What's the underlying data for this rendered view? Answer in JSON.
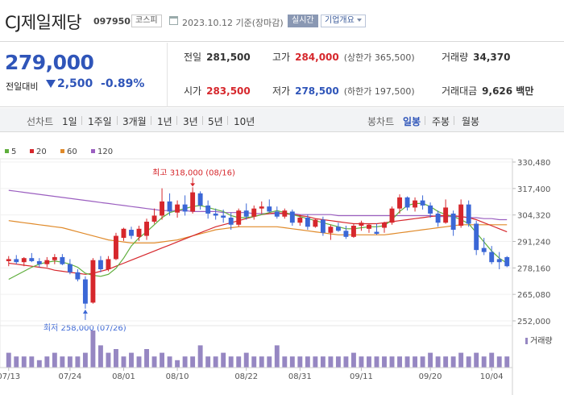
{
  "header": {
    "company": "CJ제일제당",
    "code": "097950",
    "market": "코스피",
    "date": "2023.10.12 기준(장마감)",
    "live_label": "실시간",
    "company_info_label": "기업개요"
  },
  "price": {
    "current": "279,000",
    "vs_prev_label": "전일대비",
    "change_amount": "2,500",
    "change_pct": "-0.89%",
    "prev_close_label": "전일",
    "prev_close": "281,500",
    "high_label": "고가",
    "high": "284,000",
    "upper_limit": "(상한가 365,500)",
    "volume_label": "거래량",
    "volume": "34,370",
    "open_label": "시가",
    "open": "283,500",
    "low_label": "저가",
    "low": "278,500",
    "lower_limit": "(하한가 197,500)",
    "amount_label": "거래대금",
    "amount": "9,626 백만"
  },
  "toolbar": {
    "line_label": "선차트",
    "periods": [
      "1일",
      "1주일",
      "3개월",
      "1년",
      "3년",
      "5년",
      "10년"
    ],
    "candle_label": "봉차트",
    "candle_periods": [
      "일봉",
      "주봉",
      "월봉"
    ],
    "active_candle": "일봉"
  },
  "legend": [
    {
      "label": "5",
      "color": "#5fae3c"
    },
    {
      "label": "20",
      "color": "#d6272c"
    },
    {
      "label": "60",
      "color": "#e08a2a"
    },
    {
      "label": "120",
      "color": "#9b5fc0"
    }
  ],
  "chart_data": {
    "type": "candlestick",
    "y_ticks": [
      "330,480",
      "317,400",
      "304,320",
      "291,240",
      "278,160",
      "265,080",
      "252,000"
    ],
    "ylim": [
      252000,
      330480
    ],
    "x_labels": [
      "07/13",
      "07/24",
      "08/01",
      "08/10",
      "08/22",
      "08/31",
      "09/11",
      "09/20",
      "10/04"
    ],
    "max_annotation": "최고 318,000 (08/16)",
    "min_annotation": "최저 258,000 (07/26)",
    "volume_legend": "거래량",
    "colors": {
      "up": "#d6272c",
      "down": "#3b67d6",
      "volume": "#9687c2"
    },
    "candles": [
      {
        "o": 281500,
        "h": 284000,
        "l": 279000,
        "c": 282500
      },
      {
        "o": 282500,
        "h": 284500,
        "l": 280000,
        "c": 281000
      },
      {
        "o": 281000,
        "h": 283500,
        "l": 279000,
        "c": 283000
      },
      {
        "o": 283000,
        "h": 285500,
        "l": 281000,
        "c": 281500
      },
      {
        "o": 281500,
        "h": 283000,
        "l": 278500,
        "c": 280000
      },
      {
        "o": 280000,
        "h": 283500,
        "l": 278500,
        "c": 282000
      },
      {
        "o": 282000,
        "h": 285000,
        "l": 280000,
        "c": 283500
      },
      {
        "o": 283500,
        "h": 285000,
        "l": 279500,
        "c": 280000
      },
      {
        "o": 280000,
        "h": 282500,
        "l": 275000,
        "c": 276000
      },
      {
        "o": 276000,
        "h": 277500,
        "l": 271500,
        "c": 272500
      },
      {
        "o": 272500,
        "h": 274000,
        "l": 258000,
        "c": 260500
      },
      {
        "o": 261000,
        "h": 283000,
        "l": 260500,
        "c": 282000
      },
      {
        "o": 282000,
        "h": 284000,
        "l": 276000,
        "c": 277500
      },
      {
        "o": 277500,
        "h": 284000,
        "l": 276500,
        "c": 282500
      },
      {
        "o": 282500,
        "h": 295500,
        "l": 282000,
        "c": 294000
      },
      {
        "o": 293000,
        "h": 298000,
        "l": 291500,
        "c": 297500
      },
      {
        "o": 297000,
        "h": 298500,
        "l": 292500,
        "c": 294000
      },
      {
        "o": 293500,
        "h": 299000,
        "l": 291500,
        "c": 297500
      },
      {
        "o": 294000,
        "h": 302500,
        "l": 292000,
        "c": 301000
      },
      {
        "o": 301000,
        "h": 307500,
        "l": 300000,
        "c": 304000
      },
      {
        "o": 304000,
        "h": 317500,
        "l": 302000,
        "c": 311000
      },
      {
        "o": 311000,
        "h": 315000,
        "l": 304000,
        "c": 306000
      },
      {
        "o": 305500,
        "h": 311500,
        "l": 303000,
        "c": 309500
      },
      {
        "o": 309500,
        "h": 314000,
        "l": 304000,
        "c": 306000
      },
      {
        "o": 306000,
        "h": 318000,
        "l": 305000,
        "c": 315500
      },
      {
        "o": 315000,
        "h": 316000,
        "l": 307000,
        "c": 309000
      },
      {
        "o": 309000,
        "h": 311500,
        "l": 302500,
        "c": 305000
      },
      {
        "o": 305000,
        "h": 307500,
        "l": 302000,
        "c": 304000
      },
      {
        "o": 304000,
        "h": 307000,
        "l": 300500,
        "c": 303000
      },
      {
        "o": 303000,
        "h": 305500,
        "l": 297000,
        "c": 299500
      },
      {
        "o": 299500,
        "h": 307500,
        "l": 298500,
        "c": 306500
      },
      {
        "o": 306500,
        "h": 310000,
        "l": 302000,
        "c": 303500
      },
      {
        "o": 303500,
        "h": 309000,
        "l": 302000,
        "c": 307500
      },
      {
        "o": 307500,
        "h": 311000,
        "l": 305000,
        "c": 308500
      },
      {
        "o": 308500,
        "h": 312000,
        "l": 305500,
        "c": 306000
      },
      {
        "o": 306000,
        "h": 308500,
        "l": 302500,
        "c": 303500
      },
      {
        "o": 303500,
        "h": 307500,
        "l": 302500,
        "c": 306500
      },
      {
        "o": 306000,
        "h": 307000,
        "l": 299000,
        "c": 300500
      },
      {
        "o": 300500,
        "h": 304500,
        "l": 299000,
        "c": 303000
      },
      {
        "o": 303000,
        "h": 304500,
        "l": 297000,
        "c": 298500
      },
      {
        "o": 298500,
        "h": 302500,
        "l": 298000,
        "c": 302000
      },
      {
        "o": 302000,
        "h": 303500,
        "l": 294000,
        "c": 295500
      },
      {
        "o": 295500,
        "h": 299500,
        "l": 292000,
        "c": 298500
      },
      {
        "o": 298500,
        "h": 300500,
        "l": 296000,
        "c": 296500
      },
      {
        "o": 296500,
        "h": 299000,
        "l": 292500,
        "c": 293500
      },
      {
        "o": 293500,
        "h": 300000,
        "l": 293000,
        "c": 299000
      },
      {
        "o": 299000,
        "h": 301500,
        "l": 296500,
        "c": 300500
      },
      {
        "o": 297500,
        "h": 300000,
        "l": 295500,
        "c": 299500
      },
      {
        "o": 296000,
        "h": 300000,
        "l": 294500,
        "c": 295000
      },
      {
        "o": 298000,
        "h": 301000,
        "l": 295500,
        "c": 300500
      },
      {
        "o": 300500,
        "h": 308500,
        "l": 299500,
        "c": 307500
      },
      {
        "o": 307500,
        "h": 314500,
        "l": 305000,
        "c": 313000
      },
      {
        "o": 313000,
        "h": 313500,
        "l": 306500,
        "c": 308000
      },
      {
        "o": 308000,
        "h": 313000,
        "l": 306000,
        "c": 311500
      },
      {
        "o": 311500,
        "h": 314000,
        "l": 307000,
        "c": 309000
      },
      {
        "o": 309000,
        "h": 310500,
        "l": 303000,
        "c": 305000
      },
      {
        "o": 305000,
        "h": 306500,
        "l": 298500,
        "c": 300500
      },
      {
        "o": 300500,
        "h": 312000,
        "l": 300000,
        "c": 308000
      },
      {
        "o": 305000,
        "h": 306500,
        "l": 294000,
        "c": 297000
      },
      {
        "o": 299000,
        "h": 312000,
        "l": 298000,
        "c": 309500
      },
      {
        "o": 309500,
        "h": 311500,
        "l": 298500,
        "c": 300000
      },
      {
        "o": 300000,
        "h": 301500,
        "l": 284500,
        "c": 287000
      },
      {
        "o": 288000,
        "h": 293000,
        "l": 284500,
        "c": 286000
      },
      {
        "o": 286000,
        "h": 289000,
        "l": 280000,
        "c": 281000
      },
      {
        "o": 282500,
        "h": 286000,
        "l": 277500,
        "c": 281000
      },
      {
        "o": 283500,
        "h": 284000,
        "l": 278500,
        "c": 279000
      }
    ],
    "volumes": [
      4,
      3,
      3,
      3,
      2,
      3,
      4,
      3,
      3,
      3,
      4,
      10,
      6,
      4,
      5,
      3,
      4,
      3,
      5,
      3,
      4,
      3,
      2,
      3,
      3,
      6,
      3,
      3,
      4,
      3,
      3,
      4,
      3,
      3,
      3,
      6,
      3,
      3,
      3,
      3,
      3,
      3,
      3,
      3,
      3,
      4,
      3,
      3,
      3,
      3,
      3,
      3,
      3,
      3,
      3,
      4,
      3,
      3,
      3,
      4,
      3,
      4,
      3,
      4,
      3,
      3
    ],
    "ma5": [
      272500,
      274500,
      276500,
      278500,
      280000,
      281000,
      281500,
      281000,
      280000,
      278500,
      275500,
      274500,
      274000,
      275000,
      278000,
      283000,
      289000,
      293000,
      296000,
      299500,
      303000,
      305500,
      306500,
      307500,
      308500,
      309000,
      308000,
      307000,
      306000,
      304000,
      303000,
      303000,
      303500,
      304500,
      305500,
      306500,
      305500,
      304500,
      303500,
      302500,
      301500,
      300500,
      299500,
      298500,
      297500,
      297500,
      298000,
      298500,
      298500,
      299000,
      302000,
      306000,
      309000,
      310000,
      310000,
      308500,
      306000,
      304500,
      303500,
      302000,
      300000,
      295500,
      291000,
      286500,
      283000,
      280500
    ],
    "ma20": [
      280500,
      280000,
      279500,
      279000,
      278500,
      278000,
      277000,
      276500,
      276000,
      275500,
      275000,
      275500,
      276500,
      277500,
      279000,
      280500,
      282000,
      283500,
      285000,
      286500,
      288000,
      289500,
      291000,
      292500,
      294000,
      295500,
      297000,
      298500,
      299500,
      300500,
      301500,
      302500,
      303500,
      304500,
      305000,
      305500,
      305000,
      304500,
      304000,
      303500,
      302500,
      302000,
      301500,
      301000,
      300500,
      300000,
      300000,
      300000,
      300000,
      300500,
      301000,
      301500,
      302000,
      302500,
      303000,
      303500,
      304000,
      304000,
      304000,
      303500,
      303000,
      302000,
      300500,
      299000,
      297500,
      296000
    ],
    "ma60": [
      301500,
      301000,
      300500,
      300000,
      299500,
      299000,
      298500,
      298000,
      297000,
      296000,
      295000,
      294000,
      293000,
      292000,
      291500,
      291000,
      290500,
      290500,
      290500,
      290500,
      291000,
      291500,
      292000,
      293000,
      294000,
      295000,
      296000,
      297000,
      297500,
      298000,
      298500,
      298500,
      298500,
      298500,
      298500,
      298500,
      298000,
      297500,
      297000,
      296500,
      296000,
      295500,
      295000,
      294500,
      294500,
      294500,
      294500,
      294500,
      294500,
      294500,
      295000,
      295500,
      296000,
      296500,
      297000,
      297500,
      298000,
      298500,
      299000,
      299500,
      299500,
      299500,
      299500,
      299500,
      299500,
      299500
    ],
    "ma120": [
      316500,
      316000,
      315500,
      315000,
      314500,
      314000,
      313500,
      313000,
      312500,
      312000,
      311500,
      311000,
      310500,
      310000,
      309500,
      309000,
      308500,
      308000,
      307500,
      307000,
      306500,
      306500,
      306500,
      306500,
      306000,
      306000,
      306000,
      306000,
      305500,
      305500,
      305500,
      305500,
      305000,
      305000,
      305000,
      305000,
      305000,
      305000,
      304500,
      304500,
      304500,
      304500,
      304500,
      304000,
      304000,
      304000,
      304000,
      304000,
      304000,
      304000,
      304000,
      304000,
      304000,
      304000,
      304000,
      304000,
      303500,
      303500,
      303500,
      303500,
      303000,
      303000,
      302500,
      302500,
      302000,
      302000
    ]
  }
}
